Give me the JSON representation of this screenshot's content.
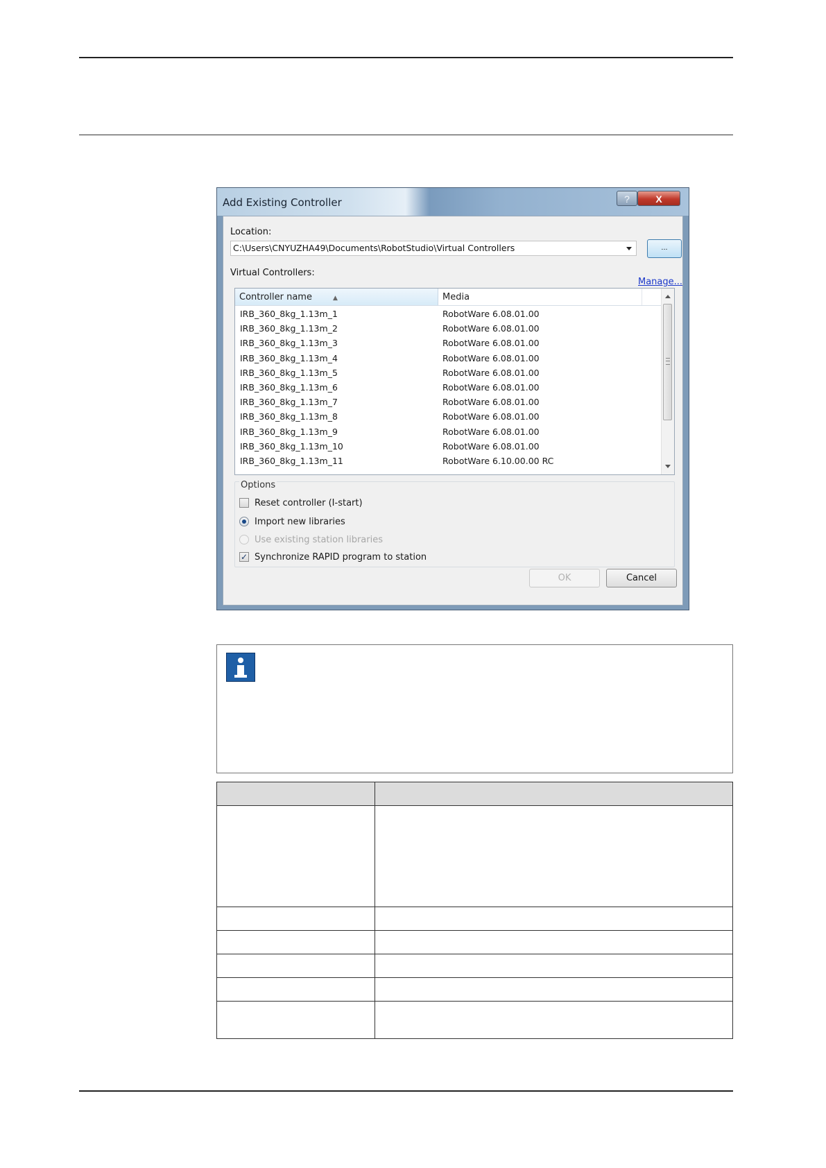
{
  "dialog": {
    "title": "Add Existing Controller",
    "help_button": "?",
    "close_button": "X",
    "location_label": "Location:",
    "location_value": "C:\\Users\\CNYUZHA49\\Documents\\RobotStudio\\Virtual Controllers",
    "browse_button": "...",
    "virtual_controllers_label": "Virtual Controllers:",
    "manage_link": "Manage...",
    "columns": [
      "Controller name",
      "Media"
    ],
    "rows": [
      {
        "name": "IRB_360_8kg_1.13m_1",
        "media": "RobotWare 6.08.01.00"
      },
      {
        "name": "IRB_360_8kg_1.13m_2",
        "media": "RobotWare 6.08.01.00"
      },
      {
        "name": "IRB_360_8kg_1.13m_3",
        "media": "RobotWare 6.08.01.00"
      },
      {
        "name": "IRB_360_8kg_1.13m_4",
        "media": "RobotWare 6.08.01.00"
      },
      {
        "name": "IRB_360_8kg_1.13m_5",
        "media": "RobotWare 6.08.01.00"
      },
      {
        "name": "IRB_360_8kg_1.13m_6",
        "media": "RobotWare 6.08.01.00"
      },
      {
        "name": "IRB_360_8kg_1.13m_7",
        "media": "RobotWare 6.08.01.00"
      },
      {
        "name": "IRB_360_8kg_1.13m_8",
        "media": "RobotWare 6.08.01.00"
      },
      {
        "name": "IRB_360_8kg_1.13m_9",
        "media": "RobotWare 6.08.01.00"
      },
      {
        "name": "IRB_360_8kg_1.13m_10",
        "media": "RobotWare 6.08.01.00"
      },
      {
        "name": "IRB_360_8kg_1.13m_11",
        "media": "RobotWare 6.10.00.00 RC"
      }
    ],
    "options_label": "Options",
    "options": {
      "reset_controller": {
        "label": "Reset controller (I-start)",
        "checked": false
      },
      "import_new_libraries": {
        "label": "Import new libraries",
        "selected": true
      },
      "use_existing_libraries": {
        "label": "Use existing station libraries",
        "selected": false,
        "disabled": true
      },
      "synchronize_rapid": {
        "label": "Synchronize RAPID program to station",
        "checked": true
      }
    },
    "ok_button": "OK",
    "cancel_button": "Cancel"
  }
}
